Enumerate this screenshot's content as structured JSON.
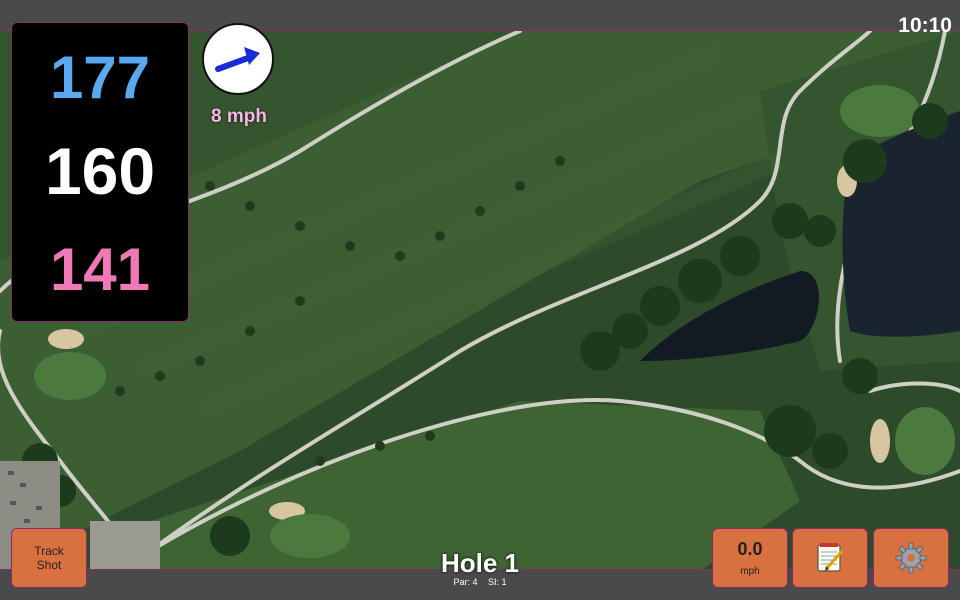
{
  "status": {
    "time": "10:10"
  },
  "yardages": {
    "back": "177",
    "middle": "160",
    "front": "141"
  },
  "wind": {
    "speed": "8 mph",
    "icon": "wind-arrow-icon"
  },
  "buttons": {
    "track_shot": "Track\nShot",
    "speed_value": "0.0",
    "speed_unit": "mph",
    "notes_icon": "notepad-icon",
    "settings_icon": "gear-icon"
  },
  "hole": {
    "title": "Hole 1",
    "par": "Par: 4",
    "si": "SI: 1"
  },
  "colors": {
    "back_yardage": "#5aa8f0",
    "middle_yardage": "#ffffff",
    "front_yardage": "#f07ab8",
    "button_bg": "#d9703f",
    "border_accent": "#8a2a6a"
  }
}
